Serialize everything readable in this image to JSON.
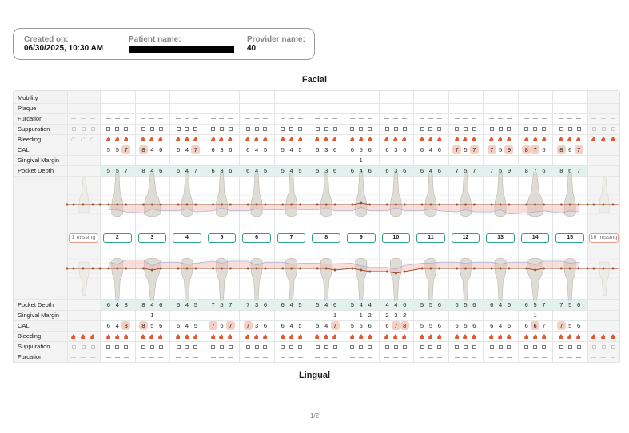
{
  "header": {
    "created_label": "Created on:",
    "created_value": "06/30/2025, 10:30 AM",
    "patient_label": "Patient name:",
    "provider_label": "Provider name:",
    "provider_value": "40"
  },
  "facial_title": "Facial",
  "lingual_title": "Lingual",
  "page_number": "1/2",
  "colors": {
    "accent": "#2ea083",
    "bleeding": "#e05a33",
    "highlight": "#f6cfc3",
    "band": "#e2f1ee",
    "line": "#a0522d"
  },
  "row_labels": {
    "mobility": "Mobility",
    "plaque": "Plaque",
    "furcation": "Furcation",
    "suppuration": "Suppuration",
    "bleeding": "Bleeding",
    "cal": "CAL",
    "gingival_margin": "Gingival Margin",
    "pocket_depth": "Pocket Depth"
  },
  "teeth": [
    {
      "label": "2"
    },
    {
      "label": "3"
    },
    {
      "label": "4"
    },
    {
      "label": "5"
    },
    {
      "label": "6"
    },
    {
      "label": "7"
    },
    {
      "label": "8"
    },
    {
      "label": "9"
    },
    {
      "label": "10"
    },
    {
      "label": "11"
    },
    {
      "label": "12"
    },
    {
      "label": "13"
    },
    {
      "label": "14"
    },
    {
      "label": "15"
    }
  ],
  "missing": {
    "left": "1 missing",
    "right": "16 missing"
  },
  "facial": {
    "cal": [
      [
        "5",
        "5",
        "7"
      ],
      [
        "8",
        "4",
        "6"
      ],
      [
        "6",
        "4",
        "7"
      ],
      [
        "6",
        "3",
        "6"
      ],
      [
        "6",
        "4",
        "5"
      ],
      [
        "5",
        "4",
        "5"
      ],
      [
        "5",
        "3",
        "6"
      ],
      [
        "6",
        "5",
        "6"
      ],
      [
        "6",
        "3",
        "6"
      ],
      [
        "6",
        "4",
        "6"
      ],
      [
        "7",
        "5",
        "7"
      ],
      [
        "7",
        "5",
        "9"
      ],
      [
        "8",
        "7",
        "6"
      ],
      [
        "8",
        "6",
        "7"
      ]
    ],
    "cal_hl": [
      [
        0,
        0,
        1
      ],
      [
        1,
        0,
        0
      ],
      [
        0,
        0,
        1
      ],
      [
        0,
        0,
        0
      ],
      [
        0,
        0,
        0
      ],
      [
        0,
        0,
        0
      ],
      [
        0,
        0,
        0
      ],
      [
        0,
        0,
        0
      ],
      [
        0,
        0,
        0
      ],
      [
        0,
        0,
        0
      ],
      [
        1,
        0,
        1
      ],
      [
        1,
        0,
        1
      ],
      [
        1,
        1,
        0
      ],
      [
        1,
        0,
        1
      ]
    ],
    "gm": [
      [
        "",
        "",
        ""
      ],
      [
        "",
        "",
        ""
      ],
      [
        "",
        "",
        ""
      ],
      [
        "",
        "",
        ""
      ],
      [
        "",
        "",
        ""
      ],
      [
        "",
        "",
        ""
      ],
      [
        "",
        "",
        ""
      ],
      [
        "",
        "1",
        ""
      ],
      [
        "",
        "",
        ""
      ],
      [
        "",
        "",
        ""
      ],
      [
        "",
        "",
        ""
      ],
      [
        "",
        "",
        ""
      ],
      [
        "",
        "",
        ""
      ],
      [
        "",
        "",
        ""
      ]
    ],
    "pd": [
      [
        "5",
        "5",
        "7"
      ],
      [
        "8",
        "4",
        "6"
      ],
      [
        "6",
        "4",
        "7"
      ],
      [
        "6",
        "3",
        "6"
      ],
      [
        "6",
        "4",
        "5"
      ],
      [
        "5",
        "4",
        "5"
      ],
      [
        "5",
        "3",
        "6"
      ],
      [
        "6",
        "4",
        "6"
      ],
      [
        "6",
        "3",
        "6"
      ],
      [
        "6",
        "4",
        "6"
      ],
      [
        "7",
        "5",
        "7"
      ],
      [
        "7",
        "5",
        "9"
      ],
      [
        "8",
        "7",
        "6"
      ],
      [
        "8",
        "6",
        "7"
      ]
    ]
  },
  "lingual": {
    "pd": [
      [
        "6",
        "4",
        "8"
      ],
      [
        "8",
        "4",
        "6"
      ],
      [
        "6",
        "4",
        "5"
      ],
      [
        "7",
        "5",
        "7"
      ],
      [
        "7",
        "3",
        "6"
      ],
      [
        "6",
        "4",
        "5"
      ],
      [
        "5",
        "4",
        "6"
      ],
      [
        "5",
        "4",
        "4"
      ],
      [
        "4",
        "4",
        "6"
      ],
      [
        "5",
        "5",
        "6"
      ],
      [
        "6",
        "5",
        "6"
      ],
      [
        "6",
        "4",
        "6"
      ],
      [
        "6",
        "5",
        "7"
      ],
      [
        "7",
        "5",
        "6"
      ]
    ],
    "gm": [
      [
        "",
        "",
        ""
      ],
      [
        "",
        "1",
        ""
      ],
      [
        "",
        "",
        ""
      ],
      [
        "",
        "",
        ""
      ],
      [
        "",
        "",
        ""
      ],
      [
        "",
        "",
        ""
      ],
      [
        "",
        "",
        "1"
      ],
      [
        "",
        "1",
        "2"
      ],
      [
        "2",
        "3",
        "2"
      ],
      [
        "",
        "",
        ""
      ],
      [
        "",
        "",
        ""
      ],
      [
        "",
        "",
        ""
      ],
      [
        "",
        "1",
        ""
      ],
      [
        "",
        "",
        ""
      ]
    ],
    "cal": [
      [
        "6",
        "4",
        "8"
      ],
      [
        "8",
        "5",
        "6"
      ],
      [
        "6",
        "4",
        "5"
      ],
      [
        "7",
        "5",
        "7"
      ],
      [
        "7",
        "3",
        "6"
      ],
      [
        "6",
        "4",
        "5"
      ],
      [
        "5",
        "4",
        "7"
      ],
      [
        "5",
        "5",
        "6"
      ],
      [
        "6",
        "7",
        "8"
      ],
      [
        "5",
        "5",
        "6"
      ],
      [
        "6",
        "5",
        "6"
      ],
      [
        "6",
        "4",
        "6"
      ],
      [
        "6",
        "6",
        "7"
      ],
      [
        "7",
        "5",
        "6"
      ]
    ],
    "cal_hl": [
      [
        0,
        0,
        1
      ],
      [
        1,
        0,
        0
      ],
      [
        0,
        0,
        0
      ],
      [
        1,
        0,
        1
      ],
      [
        1,
        0,
        0
      ],
      [
        0,
        0,
        0
      ],
      [
        0,
        0,
        1
      ],
      [
        0,
        0,
        0
      ],
      [
        0,
        1,
        1
      ],
      [
        0,
        0,
        0
      ],
      [
        0,
        0,
        0
      ],
      [
        0,
        0,
        0
      ],
      [
        0,
        1,
        0
      ],
      [
        1,
        0,
        0
      ]
    ]
  }
}
